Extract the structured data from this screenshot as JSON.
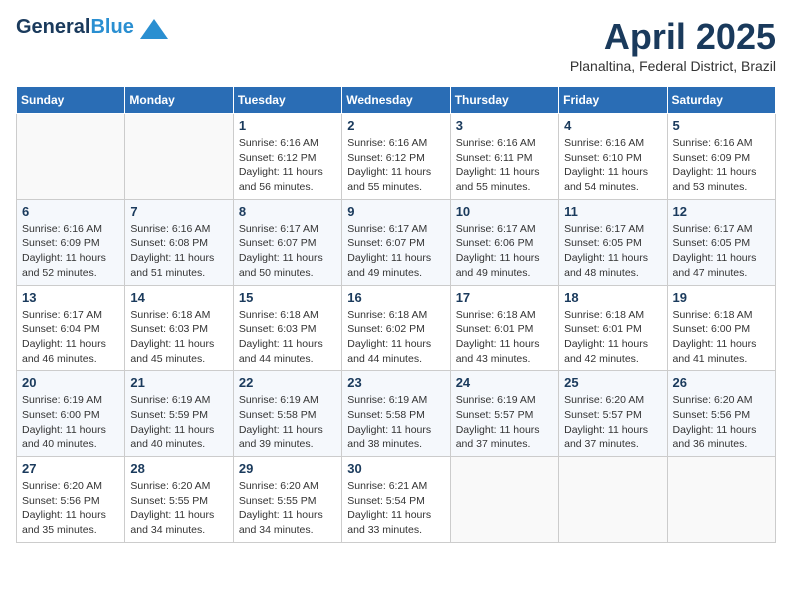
{
  "header": {
    "logo_general": "General",
    "logo_blue": "Blue",
    "month": "April 2025",
    "location": "Planaltina, Federal District, Brazil"
  },
  "weekdays": [
    "Sunday",
    "Monday",
    "Tuesday",
    "Wednesday",
    "Thursday",
    "Friday",
    "Saturday"
  ],
  "weeks": [
    [
      {
        "day": "",
        "info": ""
      },
      {
        "day": "",
        "info": ""
      },
      {
        "day": "1",
        "info": "Sunrise: 6:16 AM\nSunset: 6:12 PM\nDaylight: 11 hours and 56 minutes."
      },
      {
        "day": "2",
        "info": "Sunrise: 6:16 AM\nSunset: 6:12 PM\nDaylight: 11 hours and 55 minutes."
      },
      {
        "day": "3",
        "info": "Sunrise: 6:16 AM\nSunset: 6:11 PM\nDaylight: 11 hours and 55 minutes."
      },
      {
        "day": "4",
        "info": "Sunrise: 6:16 AM\nSunset: 6:10 PM\nDaylight: 11 hours and 54 minutes."
      },
      {
        "day": "5",
        "info": "Sunrise: 6:16 AM\nSunset: 6:09 PM\nDaylight: 11 hours and 53 minutes."
      }
    ],
    [
      {
        "day": "6",
        "info": "Sunrise: 6:16 AM\nSunset: 6:09 PM\nDaylight: 11 hours and 52 minutes."
      },
      {
        "day": "7",
        "info": "Sunrise: 6:16 AM\nSunset: 6:08 PM\nDaylight: 11 hours and 51 minutes."
      },
      {
        "day": "8",
        "info": "Sunrise: 6:17 AM\nSunset: 6:07 PM\nDaylight: 11 hours and 50 minutes."
      },
      {
        "day": "9",
        "info": "Sunrise: 6:17 AM\nSunset: 6:07 PM\nDaylight: 11 hours and 49 minutes."
      },
      {
        "day": "10",
        "info": "Sunrise: 6:17 AM\nSunset: 6:06 PM\nDaylight: 11 hours and 49 minutes."
      },
      {
        "day": "11",
        "info": "Sunrise: 6:17 AM\nSunset: 6:05 PM\nDaylight: 11 hours and 48 minutes."
      },
      {
        "day": "12",
        "info": "Sunrise: 6:17 AM\nSunset: 6:05 PM\nDaylight: 11 hours and 47 minutes."
      }
    ],
    [
      {
        "day": "13",
        "info": "Sunrise: 6:17 AM\nSunset: 6:04 PM\nDaylight: 11 hours and 46 minutes."
      },
      {
        "day": "14",
        "info": "Sunrise: 6:18 AM\nSunset: 6:03 PM\nDaylight: 11 hours and 45 minutes."
      },
      {
        "day": "15",
        "info": "Sunrise: 6:18 AM\nSunset: 6:03 PM\nDaylight: 11 hours and 44 minutes."
      },
      {
        "day": "16",
        "info": "Sunrise: 6:18 AM\nSunset: 6:02 PM\nDaylight: 11 hours and 44 minutes."
      },
      {
        "day": "17",
        "info": "Sunrise: 6:18 AM\nSunset: 6:01 PM\nDaylight: 11 hours and 43 minutes."
      },
      {
        "day": "18",
        "info": "Sunrise: 6:18 AM\nSunset: 6:01 PM\nDaylight: 11 hours and 42 minutes."
      },
      {
        "day": "19",
        "info": "Sunrise: 6:18 AM\nSunset: 6:00 PM\nDaylight: 11 hours and 41 minutes."
      }
    ],
    [
      {
        "day": "20",
        "info": "Sunrise: 6:19 AM\nSunset: 6:00 PM\nDaylight: 11 hours and 40 minutes."
      },
      {
        "day": "21",
        "info": "Sunrise: 6:19 AM\nSunset: 5:59 PM\nDaylight: 11 hours and 40 minutes."
      },
      {
        "day": "22",
        "info": "Sunrise: 6:19 AM\nSunset: 5:58 PM\nDaylight: 11 hours and 39 minutes."
      },
      {
        "day": "23",
        "info": "Sunrise: 6:19 AM\nSunset: 5:58 PM\nDaylight: 11 hours and 38 minutes."
      },
      {
        "day": "24",
        "info": "Sunrise: 6:19 AM\nSunset: 5:57 PM\nDaylight: 11 hours and 37 minutes."
      },
      {
        "day": "25",
        "info": "Sunrise: 6:20 AM\nSunset: 5:57 PM\nDaylight: 11 hours and 37 minutes."
      },
      {
        "day": "26",
        "info": "Sunrise: 6:20 AM\nSunset: 5:56 PM\nDaylight: 11 hours and 36 minutes."
      }
    ],
    [
      {
        "day": "27",
        "info": "Sunrise: 6:20 AM\nSunset: 5:56 PM\nDaylight: 11 hours and 35 minutes."
      },
      {
        "day": "28",
        "info": "Sunrise: 6:20 AM\nSunset: 5:55 PM\nDaylight: 11 hours and 34 minutes."
      },
      {
        "day": "29",
        "info": "Sunrise: 6:20 AM\nSunset: 5:55 PM\nDaylight: 11 hours and 34 minutes."
      },
      {
        "day": "30",
        "info": "Sunrise: 6:21 AM\nSunset: 5:54 PM\nDaylight: 11 hours and 33 minutes."
      },
      {
        "day": "",
        "info": ""
      },
      {
        "day": "",
        "info": ""
      },
      {
        "day": "",
        "info": ""
      }
    ]
  ]
}
